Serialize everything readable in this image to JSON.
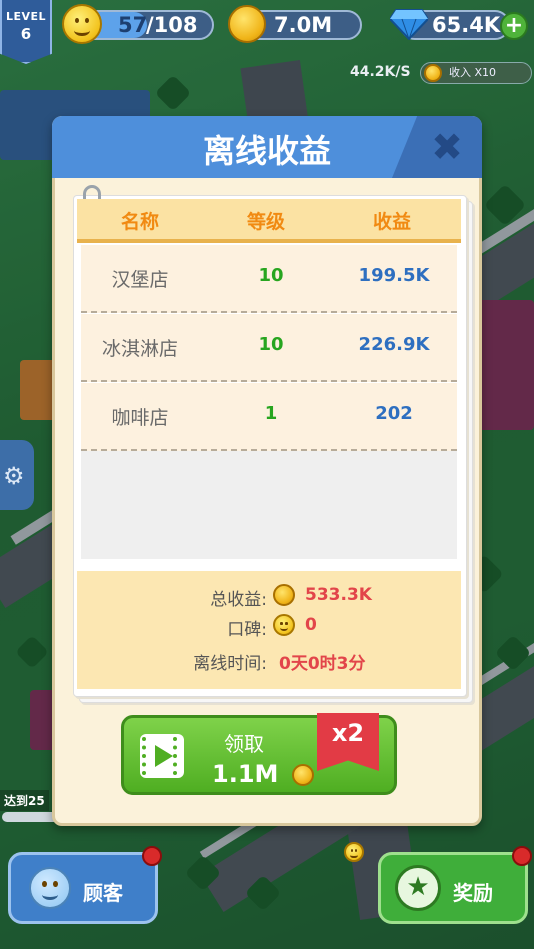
{
  "hud": {
    "level_label": "LEVEL",
    "level_value": "6",
    "reputation_current": "57",
    "reputation_total": "/108",
    "reputation_progress": 0.53,
    "coins": "7.0M",
    "gems": "65.4K",
    "rate": "44.2K/S",
    "income_boost": "收入 X10"
  },
  "side": {
    "reach_label": "达到25"
  },
  "modal": {
    "title": "离线收益",
    "close_icon": "close-x-icon",
    "columns": [
      "名称",
      "等级",
      "收益"
    ],
    "rows": [
      {
        "name": "汉堡店",
        "level": "10",
        "income": "199.5K"
      },
      {
        "name": "冰淇淋店",
        "level": "10",
        "income": "226.9K"
      },
      {
        "name": "咖啡店",
        "level": "1",
        "income": "202"
      }
    ],
    "summary": {
      "total_label": "总收益:",
      "total_value": "533.3K",
      "reputation_label": "口碑:",
      "reputation_value": "0",
      "offline_time_label": "离线时间:",
      "offline_time_value": "0天0时3分"
    },
    "claim": {
      "label": "领取",
      "amount": "1.1M",
      "multiplier": "x2"
    }
  },
  "bottom": {
    "customer_label": "顾客",
    "reward_label": "奖励"
  },
  "colors": {
    "header_blue": "#4e8fdb",
    "level_green": "#27a51f",
    "income_blue": "#2e6fc0",
    "summary_red": "#e2454a",
    "claim_green": "#4fae22",
    "ribbon_red": "#e23b45"
  }
}
